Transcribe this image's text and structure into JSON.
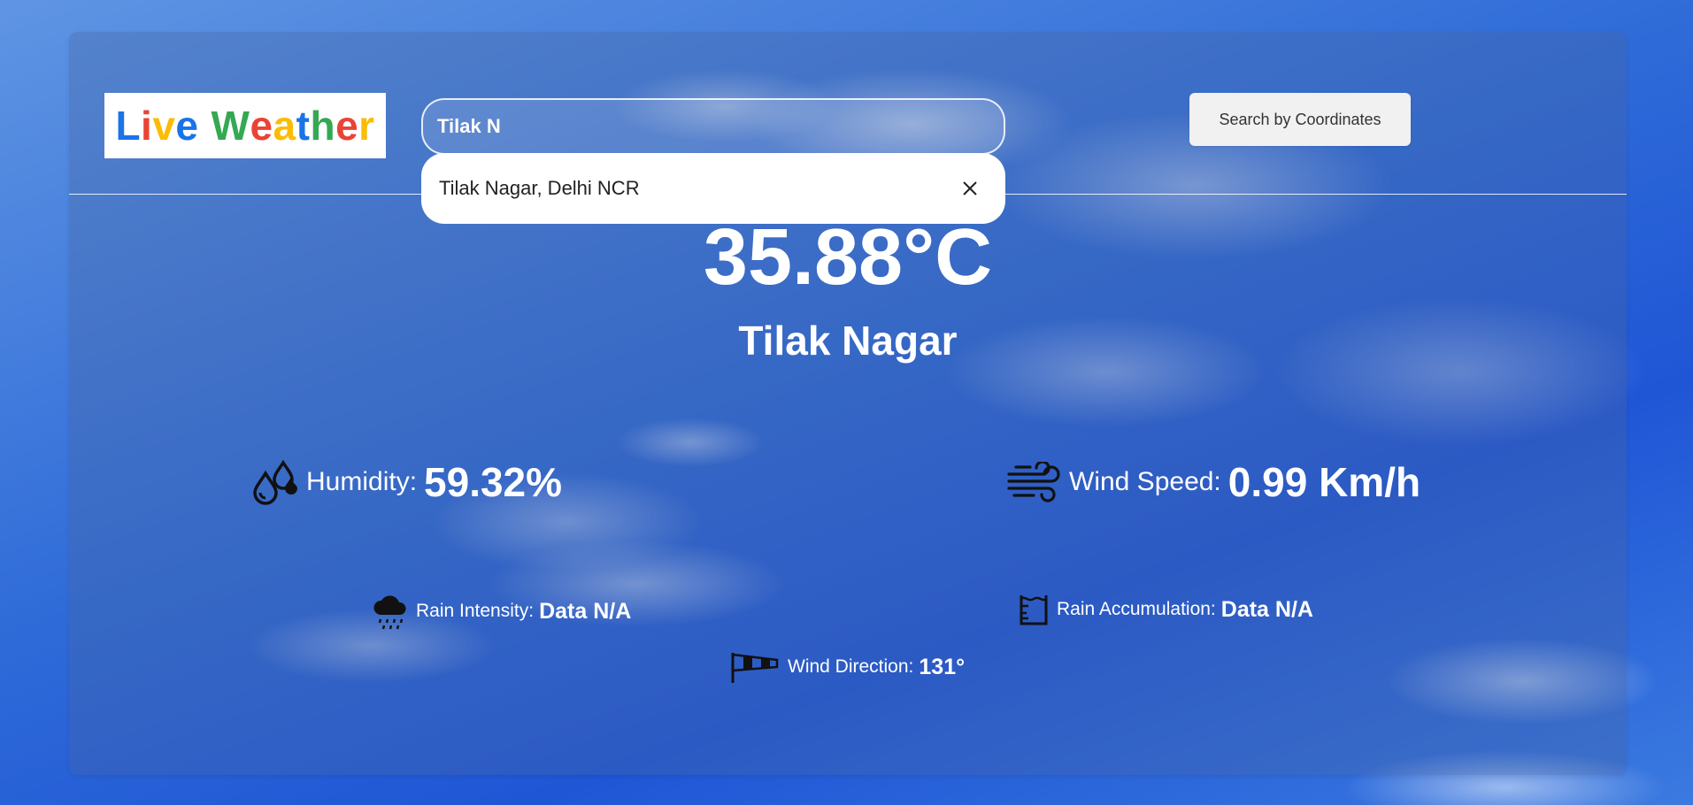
{
  "logo": {
    "letters": [
      {
        "ch": "L",
        "color": "#1a73e8"
      },
      {
        "ch": "i",
        "color": "#ea4335"
      },
      {
        "ch": "v",
        "color": "#fbbc05"
      },
      {
        "ch": "e",
        "color": "#1a73e8"
      },
      {
        "ch": "W",
        "color": "#34a853"
      },
      {
        "ch": "e",
        "color": "#ea4335"
      },
      {
        "ch": "a",
        "color": "#fbbc05"
      },
      {
        "ch": "t",
        "color": "#1a73e8"
      },
      {
        "ch": "h",
        "color": "#34a853"
      },
      {
        "ch": "e",
        "color": "#ea4335"
      },
      {
        "ch": "r",
        "color": "#fbbc05"
      }
    ]
  },
  "search": {
    "value": "Tilak N",
    "suggestion": "Tilak Nagar, Delhi NCR",
    "clear_icon": "close-icon"
  },
  "coord_button": {
    "label": "Search by Coordinates"
  },
  "current": {
    "temperature": "35.88°C",
    "city": "Tilak Nagar"
  },
  "stats": {
    "humidity": {
      "label": "Humidity:",
      "value": "59.32%",
      "icon": "humidity-drops-icon"
    },
    "wind_speed": {
      "label": "Wind Speed:",
      "value": "0.99 Km/h",
      "icon": "wind-icon"
    },
    "rain_intensity": {
      "label": "Rain Intensity:",
      "value": "Data N/A",
      "icon": "rain-cloud-icon"
    },
    "rain_accumulation": {
      "label": "Rain Accumulation:",
      "value": "Data N/A",
      "icon": "rain-gauge-icon"
    },
    "wind_direction": {
      "label": "Wind Direction:",
      "value": "131°",
      "icon": "windsock-icon"
    }
  },
  "colors": {
    "text": "#ffffff",
    "icon": "#111111"
  }
}
